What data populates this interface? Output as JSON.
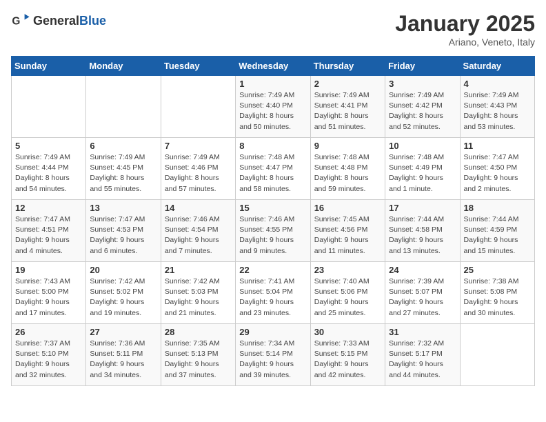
{
  "header": {
    "logo_general": "General",
    "logo_blue": "Blue",
    "title": "January 2025",
    "subtitle": "Ariano, Veneto, Italy"
  },
  "days_of_week": [
    "Sunday",
    "Monday",
    "Tuesday",
    "Wednesday",
    "Thursday",
    "Friday",
    "Saturday"
  ],
  "weeks": [
    [
      {
        "day": "",
        "info": ""
      },
      {
        "day": "",
        "info": ""
      },
      {
        "day": "",
        "info": ""
      },
      {
        "day": "1",
        "info": "Sunrise: 7:49 AM\nSunset: 4:40 PM\nDaylight: 8 hours\nand 50 minutes."
      },
      {
        "day": "2",
        "info": "Sunrise: 7:49 AM\nSunset: 4:41 PM\nDaylight: 8 hours\nand 51 minutes."
      },
      {
        "day": "3",
        "info": "Sunrise: 7:49 AM\nSunset: 4:42 PM\nDaylight: 8 hours\nand 52 minutes."
      },
      {
        "day": "4",
        "info": "Sunrise: 7:49 AM\nSunset: 4:43 PM\nDaylight: 8 hours\nand 53 minutes."
      }
    ],
    [
      {
        "day": "5",
        "info": "Sunrise: 7:49 AM\nSunset: 4:44 PM\nDaylight: 8 hours\nand 54 minutes."
      },
      {
        "day": "6",
        "info": "Sunrise: 7:49 AM\nSunset: 4:45 PM\nDaylight: 8 hours\nand 55 minutes."
      },
      {
        "day": "7",
        "info": "Sunrise: 7:49 AM\nSunset: 4:46 PM\nDaylight: 8 hours\nand 57 minutes."
      },
      {
        "day": "8",
        "info": "Sunrise: 7:48 AM\nSunset: 4:47 PM\nDaylight: 8 hours\nand 58 minutes."
      },
      {
        "day": "9",
        "info": "Sunrise: 7:48 AM\nSunset: 4:48 PM\nDaylight: 8 hours\nand 59 minutes."
      },
      {
        "day": "10",
        "info": "Sunrise: 7:48 AM\nSunset: 4:49 PM\nDaylight: 9 hours\nand 1 minute."
      },
      {
        "day": "11",
        "info": "Sunrise: 7:47 AM\nSunset: 4:50 PM\nDaylight: 9 hours\nand 2 minutes."
      }
    ],
    [
      {
        "day": "12",
        "info": "Sunrise: 7:47 AM\nSunset: 4:51 PM\nDaylight: 9 hours\nand 4 minutes."
      },
      {
        "day": "13",
        "info": "Sunrise: 7:47 AM\nSunset: 4:53 PM\nDaylight: 9 hours\nand 6 minutes."
      },
      {
        "day": "14",
        "info": "Sunrise: 7:46 AM\nSunset: 4:54 PM\nDaylight: 9 hours\nand 7 minutes."
      },
      {
        "day": "15",
        "info": "Sunrise: 7:46 AM\nSunset: 4:55 PM\nDaylight: 9 hours\nand 9 minutes."
      },
      {
        "day": "16",
        "info": "Sunrise: 7:45 AM\nSunset: 4:56 PM\nDaylight: 9 hours\nand 11 minutes."
      },
      {
        "day": "17",
        "info": "Sunrise: 7:44 AM\nSunset: 4:58 PM\nDaylight: 9 hours\nand 13 minutes."
      },
      {
        "day": "18",
        "info": "Sunrise: 7:44 AM\nSunset: 4:59 PM\nDaylight: 9 hours\nand 15 minutes."
      }
    ],
    [
      {
        "day": "19",
        "info": "Sunrise: 7:43 AM\nSunset: 5:00 PM\nDaylight: 9 hours\nand 17 minutes."
      },
      {
        "day": "20",
        "info": "Sunrise: 7:42 AM\nSunset: 5:02 PM\nDaylight: 9 hours\nand 19 minutes."
      },
      {
        "day": "21",
        "info": "Sunrise: 7:42 AM\nSunset: 5:03 PM\nDaylight: 9 hours\nand 21 minutes."
      },
      {
        "day": "22",
        "info": "Sunrise: 7:41 AM\nSunset: 5:04 PM\nDaylight: 9 hours\nand 23 minutes."
      },
      {
        "day": "23",
        "info": "Sunrise: 7:40 AM\nSunset: 5:06 PM\nDaylight: 9 hours\nand 25 minutes."
      },
      {
        "day": "24",
        "info": "Sunrise: 7:39 AM\nSunset: 5:07 PM\nDaylight: 9 hours\nand 27 minutes."
      },
      {
        "day": "25",
        "info": "Sunrise: 7:38 AM\nSunset: 5:08 PM\nDaylight: 9 hours\nand 30 minutes."
      }
    ],
    [
      {
        "day": "26",
        "info": "Sunrise: 7:37 AM\nSunset: 5:10 PM\nDaylight: 9 hours\nand 32 minutes."
      },
      {
        "day": "27",
        "info": "Sunrise: 7:36 AM\nSunset: 5:11 PM\nDaylight: 9 hours\nand 34 minutes."
      },
      {
        "day": "28",
        "info": "Sunrise: 7:35 AM\nSunset: 5:13 PM\nDaylight: 9 hours\nand 37 minutes."
      },
      {
        "day": "29",
        "info": "Sunrise: 7:34 AM\nSunset: 5:14 PM\nDaylight: 9 hours\nand 39 minutes."
      },
      {
        "day": "30",
        "info": "Sunrise: 7:33 AM\nSunset: 5:15 PM\nDaylight: 9 hours\nand 42 minutes."
      },
      {
        "day": "31",
        "info": "Sunrise: 7:32 AM\nSunset: 5:17 PM\nDaylight: 9 hours\nand 44 minutes."
      },
      {
        "day": "",
        "info": ""
      }
    ]
  ]
}
